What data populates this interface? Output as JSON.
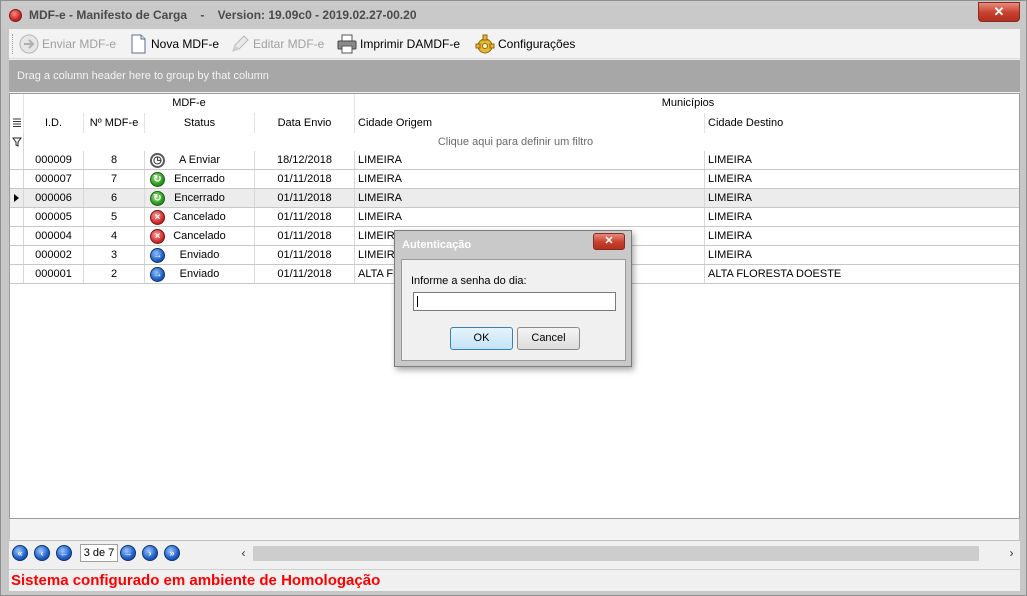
{
  "window": {
    "title": "MDF-e - Manifesto de Carga    -    Version: 19.09c0 - 2019.02.27-00.20",
    "close_glyph": "✕"
  },
  "toolbar": {
    "enviar_label": "Enviar MDF-e",
    "nova_label": "Nova MDF-e",
    "editar_label": "Editar MDF-e",
    "imprimir_label": "Imprimir DAMDF-e",
    "config_label": "Configurações"
  },
  "groupbar": {
    "text": "Drag a column header here to group by that column"
  },
  "grid": {
    "band_mdfe": "MDF-e",
    "band_municipios": "Municípios",
    "headers": {
      "id": "I.D.",
      "numero": "Nº MDF-e",
      "status": "Status",
      "data_envio": "Data Envio",
      "cidade_origem": "Cidade Origem",
      "cidade_destino": "Cidade Destino"
    },
    "filter_text": "Clique aqui para definir um filtro",
    "rows": [
      {
        "id": "000009",
        "numero": "8",
        "status": "A Enviar",
        "status_icon": "clock-icon",
        "data": "18/12/2018",
        "origem": "LIMEIRA",
        "destino": "LIMEIRA"
      },
      {
        "id": "000007",
        "numero": "7",
        "status": "Encerrado",
        "status_icon": "green-check-icon",
        "data": "01/11/2018",
        "origem": "LIMEIRA",
        "destino": "LIMEIRA"
      },
      {
        "id": "000006",
        "numero": "6",
        "status": "Encerrado",
        "status_icon": "green-check-icon",
        "data": "01/11/2018",
        "origem": "LIMEIRA",
        "destino": "LIMEIRA"
      },
      {
        "id": "000005",
        "numero": "5",
        "status": "Cancelado",
        "status_icon": "red-x-icon",
        "data": "01/11/2018",
        "origem": "LIMEIRA",
        "destino": "LIMEIRA"
      },
      {
        "id": "000004",
        "numero": "4",
        "status": "Cancelado",
        "status_icon": "red-x-icon",
        "data": "01/11/2018",
        "origem": "LIMEIRA",
        "destino": "LIMEIRA"
      },
      {
        "id": "000002",
        "numero": "3",
        "status": "Enviado",
        "status_icon": "blue-arrow-icon",
        "data": "01/11/2018",
        "origem": "LIMEIRA",
        "destino": "LIMEIRA"
      },
      {
        "id": "000001",
        "numero": "2",
        "status": "Enviado",
        "status_icon": "blue-arrow-icon",
        "data": "01/11/2018",
        "origem": "ALTA FL",
        "destino": "ALTA FLORESTA DOESTE"
      }
    ],
    "selected_row_index": 2
  },
  "pager": {
    "page_text": "3 de 7"
  },
  "footer": {
    "environment_message": "Sistema configurado em ambiente de Homologação"
  },
  "dialog": {
    "title": "Autenticação",
    "prompt": "Informe a senha do dia:",
    "password_value": "",
    "ok_label": "OK",
    "cancel_label": "Cancel"
  },
  "colors": {
    "environment_message": "#ff0000",
    "ok_button_border": "#3c7fb1",
    "groupbar_bg": "#a7a7a7"
  }
}
